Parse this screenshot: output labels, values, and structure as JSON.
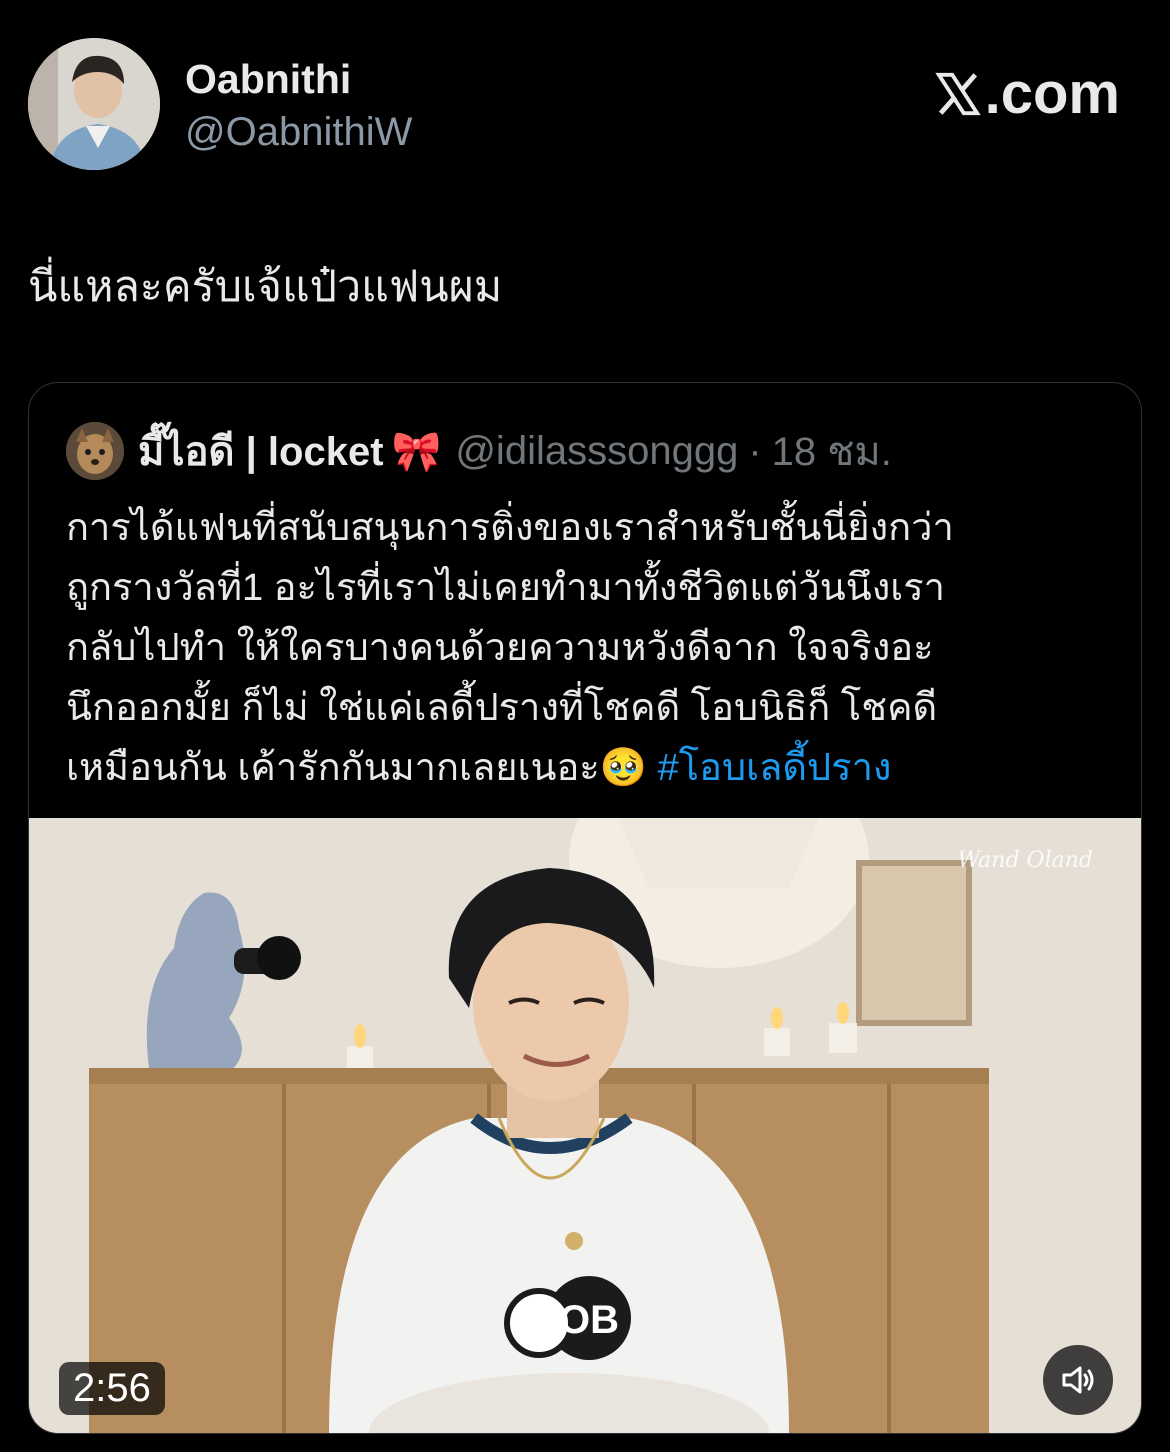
{
  "author": {
    "display_name": "Oabnithi",
    "handle": "@OabnithiW"
  },
  "brand": {
    "site": ".com"
  },
  "tweet": {
    "text": "นี่แหละครับเจ้แป๋วแฟนผม"
  },
  "quote": {
    "display_name": "มี๊ไอดี | locket",
    "emoji": "🎀",
    "handle": "@idilasssonggg",
    "separator": "·",
    "time": "18 ชม.",
    "lines": [
      "การได้แฟนที่สนับสนุนการติ่งของเราสำหรับชั้นนี่ยิ่งกว่า",
      "ถูกรางวัลที่1 อะไรที่เราไม่เคยทำมาทั้งชีวิตแต่วันนึงเรา",
      "กลับไปทำ ให้ใครบางคนด้วยความหวังดีจาก ใจจริงอะ",
      "นึกออกมั้ย ก็ไม่ ใช่แค่เลดี้ปรางที่โชคดี โอบนิธิก็ โชคดี"
    ],
    "last_line": "เหมือนกัน เค้ารักกันมากเลยเนอะ",
    "last_emoji": "🥹",
    "hashtag": "#โอบเลดี้ปราง"
  },
  "video": {
    "duration": "2:56",
    "watermark": "Wand Oland",
    "shirt_text": "OB"
  },
  "colors": {
    "background": "#000000",
    "text": "#e7e9ea",
    "muted": "#8b98a5",
    "link": "#1d9bf0",
    "border": "#2f3336"
  },
  "icons": [
    "x-logo-icon",
    "speaker-icon"
  ]
}
